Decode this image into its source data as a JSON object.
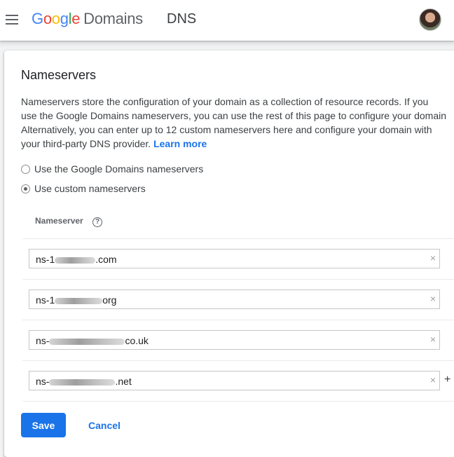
{
  "header": {
    "logo_letters": [
      "G",
      "o",
      "o",
      "g",
      "l",
      "e"
    ],
    "product": "Domains",
    "section": "DNS",
    "menu_icon": "hamburger-menu-icon",
    "avatar_icon": "user-avatar"
  },
  "nameservers": {
    "title": "Nameservers",
    "description_lines": [
      "Nameservers store the configuration of your domain as a collection of resource records. If you",
      "use the Google Domains nameservers, you can use the rest of this page to configure your domain",
      "Alternatively, you can enter up to 12 custom nameservers here and configure your domain with",
      "your third-party DNS provider."
    ],
    "learn_more": "Learn more",
    "radio_options": [
      {
        "label": "Use the Google Domains nameservers",
        "checked": false
      },
      {
        "label": "Use custom nameservers",
        "checked": true
      }
    ],
    "column_header": "Nameserver",
    "help_icon": "help-circle-icon",
    "help_glyph": "?",
    "entries": [
      {
        "prefix": "ns-1",
        "suffix": ".com"
      },
      {
        "prefix": "ns-1",
        "suffix": "org"
      },
      {
        "prefix": "ns-",
        "suffix": "co.uk"
      },
      {
        "prefix": "ns-",
        "suffix": ".net"
      }
    ],
    "clear_glyph": "×",
    "add_glyph": "+"
  },
  "actions": {
    "save_label": "Save",
    "cancel_label": "Cancel"
  },
  "colors": {
    "accent": "#1a73e8",
    "google_blue": "#4285f4",
    "google_red": "#ea4335",
    "google_yellow": "#fbbc05",
    "google_green": "#34a853"
  }
}
